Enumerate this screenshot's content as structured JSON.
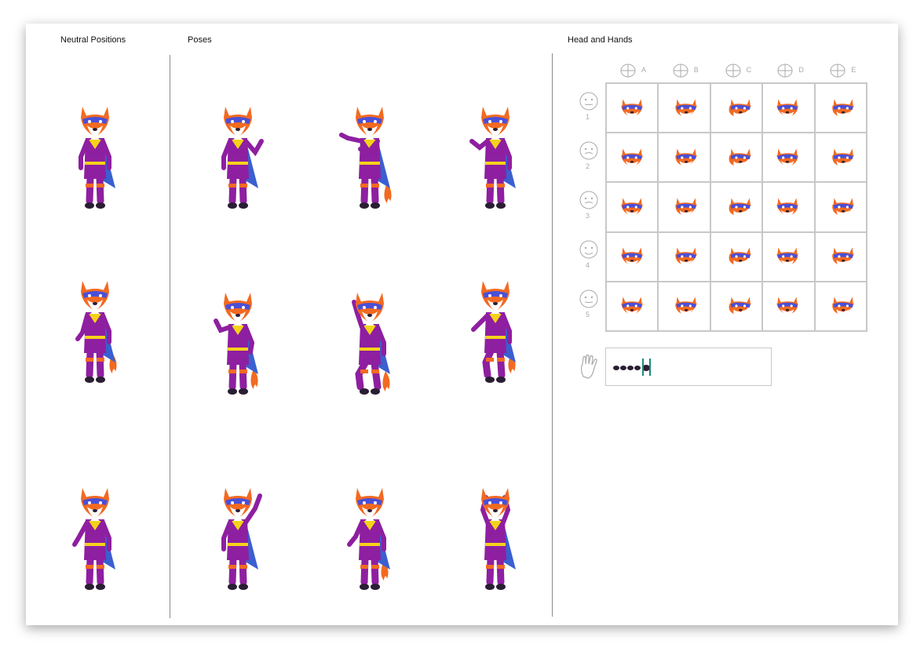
{
  "sections": {
    "neutral": "Neutral Positions",
    "poses": "Poses",
    "head_hands": "Head and Hands"
  },
  "columns": [
    "A",
    "B",
    "C",
    "D",
    "E"
  ],
  "rows": [
    "1",
    "2",
    "3",
    "4",
    "5"
  ],
  "colors": {
    "fur": "#f26a21",
    "mask": "#4a4fd8",
    "suit": "#8e1fa0",
    "cape": "#3a5fd0",
    "belt": "#f5d21a",
    "limbs": "#2a1e33",
    "grid_line": "#c8c8c8",
    "hand_accent": "#1c8a7a"
  }
}
